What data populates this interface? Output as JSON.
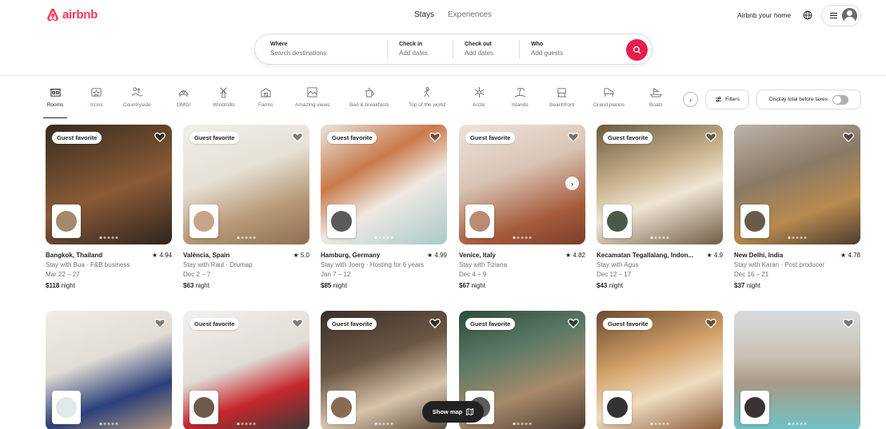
{
  "brand": {
    "name": "airbnb",
    "color": "#FF385C"
  },
  "nav": {
    "tabs": [
      {
        "label": "Stays"
      },
      {
        "label": "Experiences"
      }
    ],
    "host_link": "Airbnb your home"
  },
  "search": {
    "where_label": "Where",
    "where_placeholder": "Search destinations",
    "checkin_label": "Check in",
    "checkin_value": "Add dates",
    "checkout_label": "Check out",
    "checkout_value": "Add dates",
    "who_label": "Who",
    "who_value": "Add guests"
  },
  "categories": [
    {
      "label": "Rooms",
      "icon": "rooms-icon",
      "active": true
    },
    {
      "label": "Icons",
      "icon": "icons-icon"
    },
    {
      "label": "Countryside",
      "icon": "countryside-icon"
    },
    {
      "label": "OMG!",
      "icon": "omg-icon"
    },
    {
      "label": "Windmills",
      "icon": "windmill-icon"
    },
    {
      "label": "Farms",
      "icon": "farm-icon"
    },
    {
      "label": "Amazing views",
      "icon": "views-icon"
    },
    {
      "label": "Bed & breakfasts",
      "icon": "bnb-icon"
    },
    {
      "label": "Top of the world",
      "icon": "mountain-icon"
    },
    {
      "label": "Arctic",
      "icon": "snowflake-icon"
    },
    {
      "label": "Islands",
      "icon": "island-icon"
    },
    {
      "label": "Beachfront",
      "icon": "beach-icon"
    },
    {
      "label": "Grand pianos",
      "icon": "piano-icon"
    },
    {
      "label": "Boats",
      "icon": "boat-icon"
    }
  ],
  "filters": {
    "filters_label": "Filters",
    "taxes_label": "Display total before taxes"
  },
  "listings": [
    {
      "badge": "Guest favorite",
      "location": "Bangkok, Thailand",
      "rating": "★ 4.94",
      "host": "Stay with Bua · F&B business",
      "dates": "Mar 22 – 27",
      "price": "$118",
      "price_unit": " night"
    },
    {
      "badge": "Guest favorite",
      "location": "València, Spain",
      "rating": "★ 5.0",
      "host": "Stay with Raul · Drumap",
      "dates": "Dec 2 – 7",
      "price": "$63",
      "price_unit": " night"
    },
    {
      "badge": "Guest favorite",
      "location": "Hamburg, Germany",
      "rating": "★ 4.99",
      "host": "Stay with Joerg · Hosting for 6 years",
      "dates": "Jan 7 – 12",
      "price": "$85",
      "price_unit": " night"
    },
    {
      "badge": "Guest favorite",
      "location": "Venice, Italy",
      "rating": "★ 4.82",
      "host": "Stay with Tiziana",
      "dates": "Dec 4 – 9",
      "price": "$67",
      "price_unit": " night"
    },
    {
      "badge": "Guest favorite",
      "location": "Kecamatan Tegallalang, Indon...",
      "rating": "★ 4.9",
      "host": "Stay with Agus",
      "dates": "Dec 12 – 17",
      "price": "$43",
      "price_unit": " night"
    },
    {
      "badge": "",
      "location": "New Delhi, India",
      "rating": "★ 4.78",
      "host": "Stay with Karan · Post producer",
      "dates": "Dec 16 – 21",
      "price": "$37",
      "price_unit": " night"
    },
    {
      "badge": ""
    },
    {
      "badge": "Guest favorite"
    },
    {
      "badge": "Guest favorite"
    },
    {
      "badge": "Guest favorite"
    },
    {
      "badge": "Guest favorite"
    },
    {
      "badge": ""
    }
  ],
  "map_button": {
    "label": "Show map"
  }
}
